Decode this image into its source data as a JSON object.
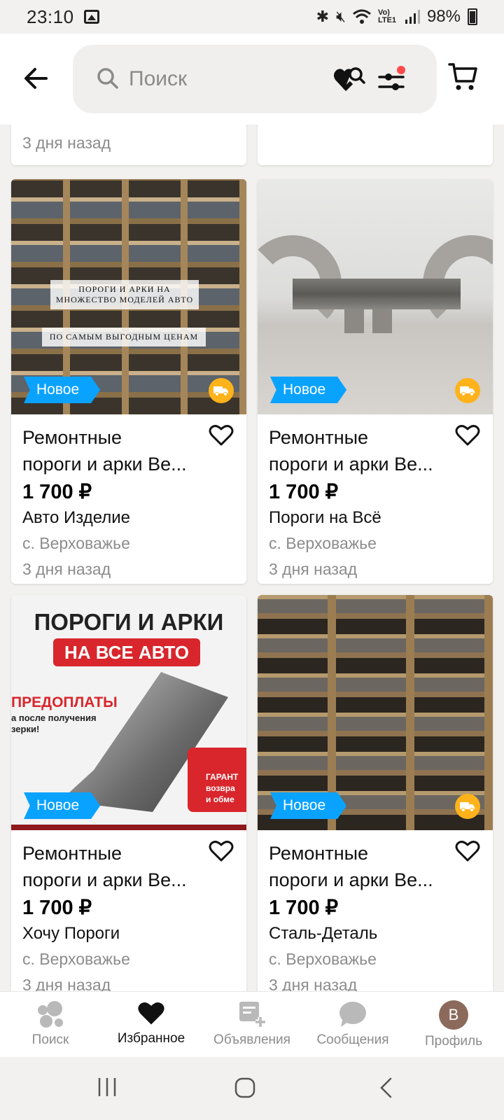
{
  "status_bar": {
    "time": "23:10",
    "battery": "98%",
    "icons": [
      "gallery-icon",
      "bluetooth-icon",
      "mute-icon",
      "wifi-icon",
      "volte-icon",
      "signal-icon",
      "battery-icon"
    ],
    "network_label": "Vo) LTE1"
  },
  "header": {
    "search_placeholder": "Поиск",
    "icons": [
      "back-arrow-icon",
      "search-icon",
      "saved-search-icon",
      "filters-icon",
      "cart-icon"
    ],
    "filters_dot_color": "#ff4a4a"
  },
  "top_partial": {
    "left_date": "3 дня назад"
  },
  "listings": [
    {
      "badge": "Новое",
      "title_line1": "Ремонтные",
      "title_line2": "пороги и арки Ве...",
      "price": "1 700 ₽",
      "seller": "Авто Изделие",
      "location": "с. Верховажье",
      "date": "3 дня назад",
      "photo_text_1": "ПОРОГИ И АРКИ НА МНОЖЕСТВО МОДЕЛЕЙ АВТО",
      "photo_text_2": "ПО САМЫМ ВЫГОДНЫМ ЦЕНАМ",
      "delivery": true
    },
    {
      "badge": "Новое",
      "title_line1": "Ремонтные",
      "title_line2": "пороги и арки Ве...",
      "price": "1 700 ₽",
      "seller": "Пороги на Всё",
      "location": "с. Верховажье",
      "date": "3 дня назад",
      "delivery": true
    },
    {
      "badge": "Новое",
      "title_line1": "Ремонтные",
      "title_line2": "пороги и арки Ве...",
      "price": "1 700 ₽",
      "seller": "Хочу Пороги",
      "location": "с. Верховажье",
      "date": "3 дня назад",
      "photo_text_1": "ПОРОГИ И АРКИ",
      "photo_text_2": "НА ВСЕ АВТО",
      "photo_text_3": "ПРЕДОПЛАТЫ",
      "photo_text_4": "а после получения",
      "photo_text_5": "зерки!",
      "photo_text_6": "ГАРАНТ",
      "photo_text_7": "возвра",
      "photo_text_8": "и обме",
      "delivery": false
    },
    {
      "badge": "Новое",
      "title_line1": "Ремонтные",
      "title_line2": "пороги и арки Ве...",
      "price": "1 700 ₽",
      "seller": "Сталь-Деталь",
      "location": "с. Верховажье",
      "date": "3 дня назад",
      "delivery": true
    }
  ],
  "bottom_nav": [
    {
      "label": "Поиск",
      "icon": "search-tab-icon",
      "active": false
    },
    {
      "label": "Избранное",
      "icon": "heart-tab-icon",
      "active": true
    },
    {
      "label": "Объявления",
      "icon": "ads-tab-icon",
      "active": false
    },
    {
      "label": "Сообщения",
      "icon": "messages-tab-icon",
      "active": false
    },
    {
      "label": "Профиль",
      "icon": "avatar",
      "active": false,
      "avatar_letter": "В"
    }
  ],
  "colors": {
    "badge_blue": "#0aa2ff",
    "delivery_orange": "#ffb21a",
    "avatar_bg": "#8b6a5c"
  }
}
